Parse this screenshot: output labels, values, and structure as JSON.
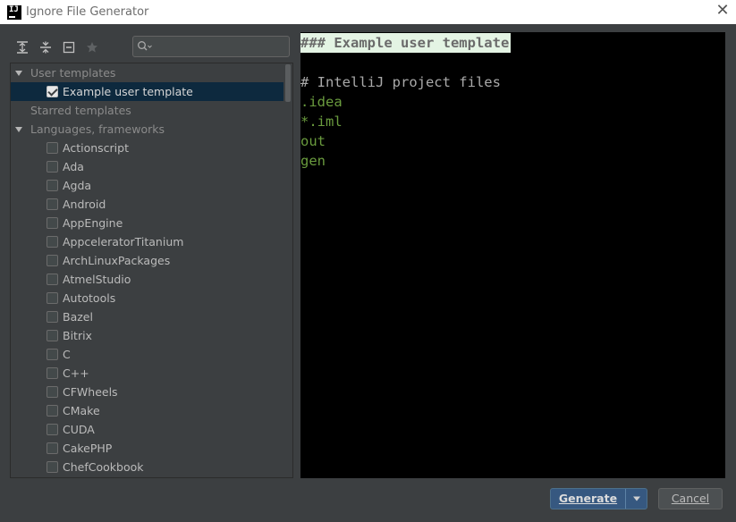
{
  "window": {
    "title": "Ignore File Generator",
    "app_icon_text": "IJ",
    "close_glyph": "✕"
  },
  "toolbar": {
    "buttons": [
      {
        "icon": "expand-all-icon"
      },
      {
        "icon": "collapse-all-icon"
      },
      {
        "icon": "unselect-all-icon"
      },
      {
        "icon": "star-icon"
      }
    ],
    "search": {
      "value": "",
      "placeholder": ""
    }
  },
  "tree": {
    "groups": [
      {
        "label": "User templates",
        "expanded": true
      },
      {
        "label": "Starred templates",
        "expanded": false
      },
      {
        "label": "Languages, frameworks",
        "expanded": true
      }
    ],
    "user_templates": [
      {
        "label": "Example user template",
        "checked": true,
        "selected": true
      }
    ],
    "languages": [
      "Actionscript",
      "Ada",
      "Agda",
      "Android",
      "AppEngine",
      "AppceleratorTitanium",
      "ArchLinuxPackages",
      "AtmelStudio",
      "Autotools",
      "Bazel",
      "Bitrix",
      "C",
      "C++",
      "CFWheels",
      "CMake",
      "CUDA",
      "CakePHP",
      "ChefCookbook"
    ]
  },
  "editor": {
    "lines": [
      {
        "text": "### Example user template",
        "kind": "heading"
      },
      {
        "text": "",
        "kind": "blank"
      },
      {
        "text": "# IntelliJ project files",
        "kind": "comment"
      },
      {
        "text": ".idea",
        "kind": "entry"
      },
      {
        "text": "*.iml",
        "kind": "entry"
      },
      {
        "text": "out",
        "kind": "entry"
      },
      {
        "text": "gen",
        "kind": "entry"
      }
    ]
  },
  "buttons": {
    "generate": "Generate",
    "cancel": "Cancel"
  },
  "colors": {
    "background": "#3c3f41",
    "selection": "#0d293e",
    "primary_button": "#365880",
    "editor_background": "#000000",
    "entry_text": "#6a9b3e",
    "heading_highlight": "#e4f4e4"
  }
}
